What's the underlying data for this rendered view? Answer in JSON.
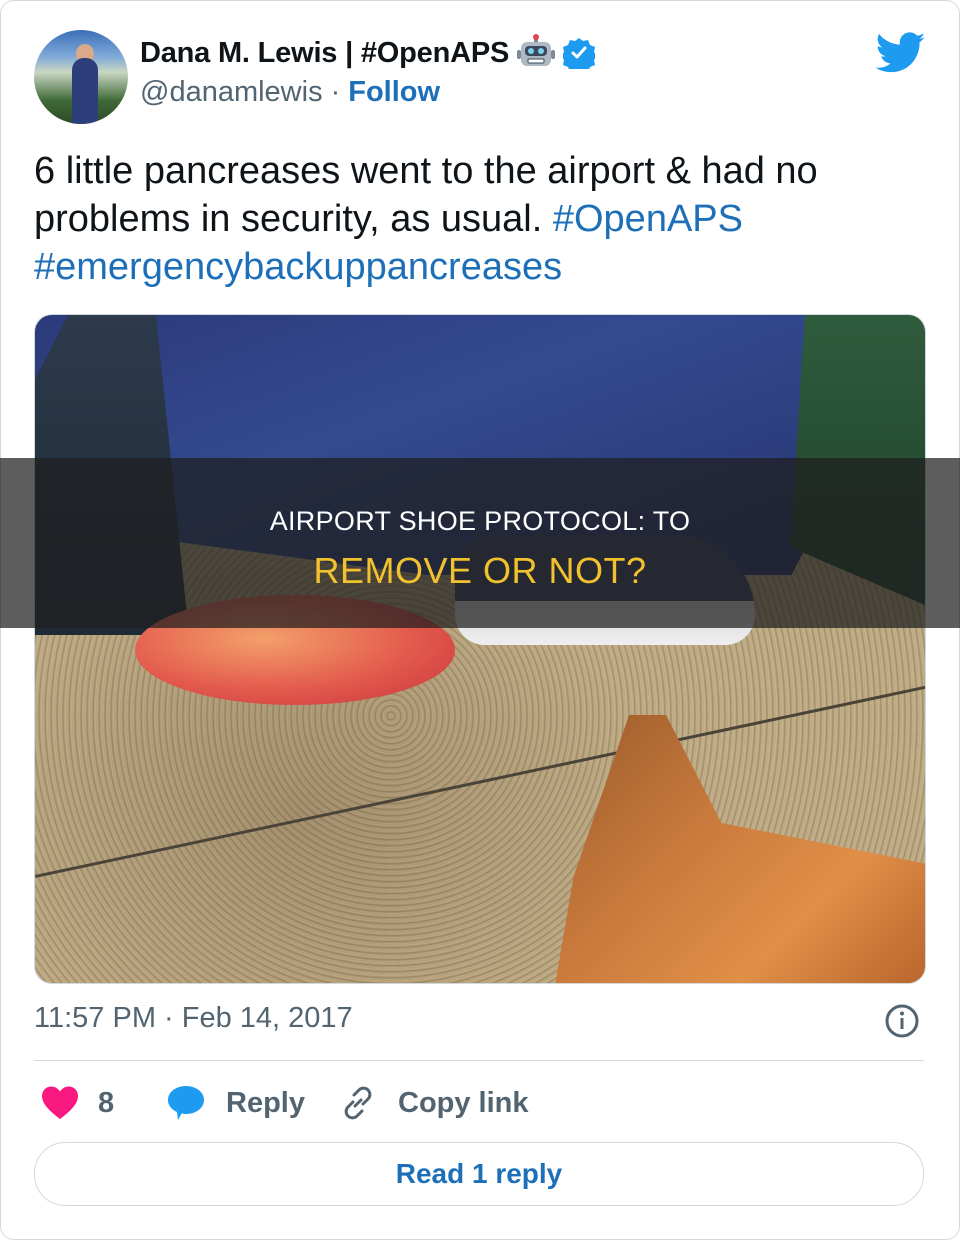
{
  "user": {
    "display_name": "Dana M. Lewis | #OpenAPS",
    "handle": "@danamlewis",
    "separator": "·",
    "follow_label": "Follow",
    "emoji_icon": "robot-icon",
    "verified_icon": "verified-badge-icon"
  },
  "tweet": {
    "text_main": "6 little pancreases went to the airport & had no problems in security, as usual.",
    "hashtag1": "#OpenAPS",
    "hashtag2": "#emergencybackuppancreases"
  },
  "overlay": {
    "line1": "AIRPORT SHOE PROTOCOL: TO",
    "line2": "REMOVE OR NOT?",
    "line2_color": "#f2c12e"
  },
  "meta": {
    "timestamp": "11:57 PM · Feb 14, 2017"
  },
  "actions": {
    "like_count": "8",
    "reply_label": "Reply",
    "copy_label": "Copy link"
  },
  "read_reply_label": "Read 1 reply",
  "colors": {
    "link_blue": "#1d6fb8",
    "twitter_blue": "#1d9bf0",
    "like_pink": "#f91880",
    "muted_text": "#536471"
  }
}
